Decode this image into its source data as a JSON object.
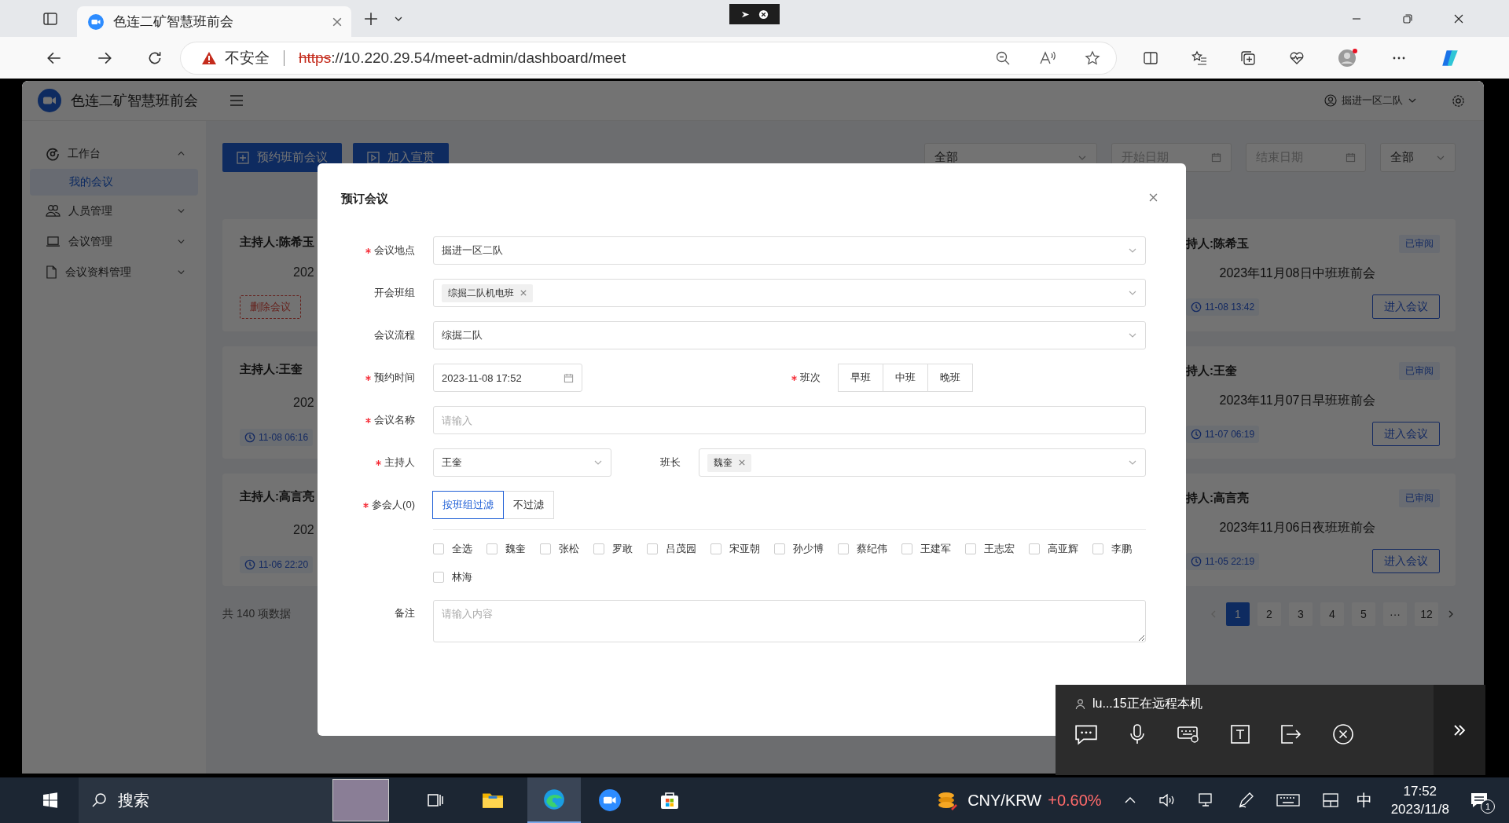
{
  "browser": {
    "tab_title": "色连二矿智慧班前会",
    "security_label": "不安全",
    "url_scheme": "https",
    "url_rest": "://10.220.29.54/meet-admin/dashboard/meet"
  },
  "app": {
    "title": "色连二矿智慧班前会",
    "user": "掘进一区二队"
  },
  "sidebar": {
    "items": [
      {
        "label": "工作台",
        "expanded": true,
        "children": [
          {
            "label": "我的会议",
            "selected": true
          }
        ]
      },
      {
        "label": "人员管理",
        "expanded": false
      },
      {
        "label": "会议管理",
        "expanded": false
      },
      {
        "label": "会议资料管理",
        "expanded": false
      }
    ]
  },
  "toolbar": {
    "buttons": [
      "预约班前会议",
      "加入宣贯"
    ],
    "status_select": "全部",
    "start_date_placeholder": "开始日期",
    "end_date_placeholder": "结束日期",
    "type_select": "全部"
  },
  "cards_left": [
    {
      "host": "主持人:陈希玉",
      "date": "202",
      "footer": {
        "kind": "button",
        "text": "删除会议"
      }
    },
    {
      "host": "主持人:王奎",
      "date": "202",
      "footer": {
        "kind": "time",
        "text": "11-08 06:16"
      }
    },
    {
      "host": "主持人:高言亮",
      "date": "202",
      "footer": {
        "kind": "time",
        "text": "11-06 22:20"
      }
    }
  ],
  "cards_right": [
    {
      "host": "持人:陈希玉",
      "badge": "已审阅",
      "title": "2023年11月08日中班班前会",
      "time": "11-08 13:42",
      "button": "进入会议"
    },
    {
      "host": "持人:王奎",
      "badge": "已审阅",
      "title": "2023年11月07日早班班前会",
      "time": "11-07 06:19",
      "button": "进入会议"
    },
    {
      "host": "持人:高言亮",
      "badge": "已审阅",
      "title": "2023年11月06日夜班班前会",
      "time": "11-05 22:19",
      "button": "进入会议"
    }
  ],
  "total": "共 140 项数据",
  "pagination": {
    "prev_disabled": true,
    "pages": [
      {
        "label": "1",
        "selected": true
      },
      {
        "label": "2",
        "selected": false
      },
      {
        "label": "3",
        "selected": false
      },
      {
        "label": "4",
        "selected": false
      },
      {
        "label": "5",
        "selected": false
      },
      {
        "label": "···",
        "selected": false
      },
      {
        "label": "12",
        "selected": false
      }
    ]
  },
  "dialog": {
    "title": "预订会议",
    "location": {
      "label": "会议地点",
      "required": true,
      "value": "掘进一区二队"
    },
    "team": {
      "label": "开会班组",
      "required": false,
      "tags": [
        "综掘二队机电班"
      ]
    },
    "process": {
      "label": "会议流程",
      "required": false,
      "value": "综掘二队"
    },
    "time": {
      "label": "预约时间",
      "required": true,
      "value": "2023-11-08 17:52"
    },
    "shift": {
      "label": "班次",
      "required": true,
      "options": [
        {
          "label": "早班",
          "selected": false
        },
        {
          "label": "中班",
          "selected": false
        },
        {
          "label": "晚班",
          "selected": false
        }
      ]
    },
    "name": {
      "label": "会议名称",
      "required": true,
      "placeholder": "请输入"
    },
    "host": {
      "label": "主持人",
      "required": true,
      "value": "王奎"
    },
    "leader": {
      "label": "班长",
      "required": false,
      "tags": [
        "魏奎"
      ]
    },
    "participants": {
      "label": "参会人(0)",
      "required": true,
      "filters": [
        {
          "label": "按班组过滤",
          "selected": true
        },
        {
          "label": "不过滤",
          "selected": false
        }
      ],
      "people": [
        {
          "label": "全选",
          "checked": false
        },
        {
          "label": "魏奎",
          "checked": false
        },
        {
          "label": "张松",
          "checked": false
        },
        {
          "label": "罗敢",
          "checked": false
        },
        {
          "label": "吕茂园",
          "checked": false
        },
        {
          "label": "宋亚朝",
          "checked": false
        },
        {
          "label": "孙少博",
          "checked": false
        },
        {
          "label": "蔡纪伟",
          "checked": false
        },
        {
          "label": "王建军",
          "checked": false
        },
        {
          "label": "王志宏",
          "checked": false
        },
        {
          "label": "高亚辉",
          "checked": false
        },
        {
          "label": "李鹏",
          "checked": false
        },
        {
          "label": "林海",
          "checked": false
        }
      ]
    },
    "remark": {
      "label": "备注",
      "required": false,
      "placeholder": "请输入内容"
    }
  },
  "remote": {
    "status": "lu...15正在远程本机"
  },
  "taskbar": {
    "search": "搜索",
    "stock_pair": "CNY/KRW",
    "stock_change": "+0.60%",
    "ime": "中",
    "time": "17:52",
    "date": "2023/11/8",
    "notifications": "1"
  }
}
